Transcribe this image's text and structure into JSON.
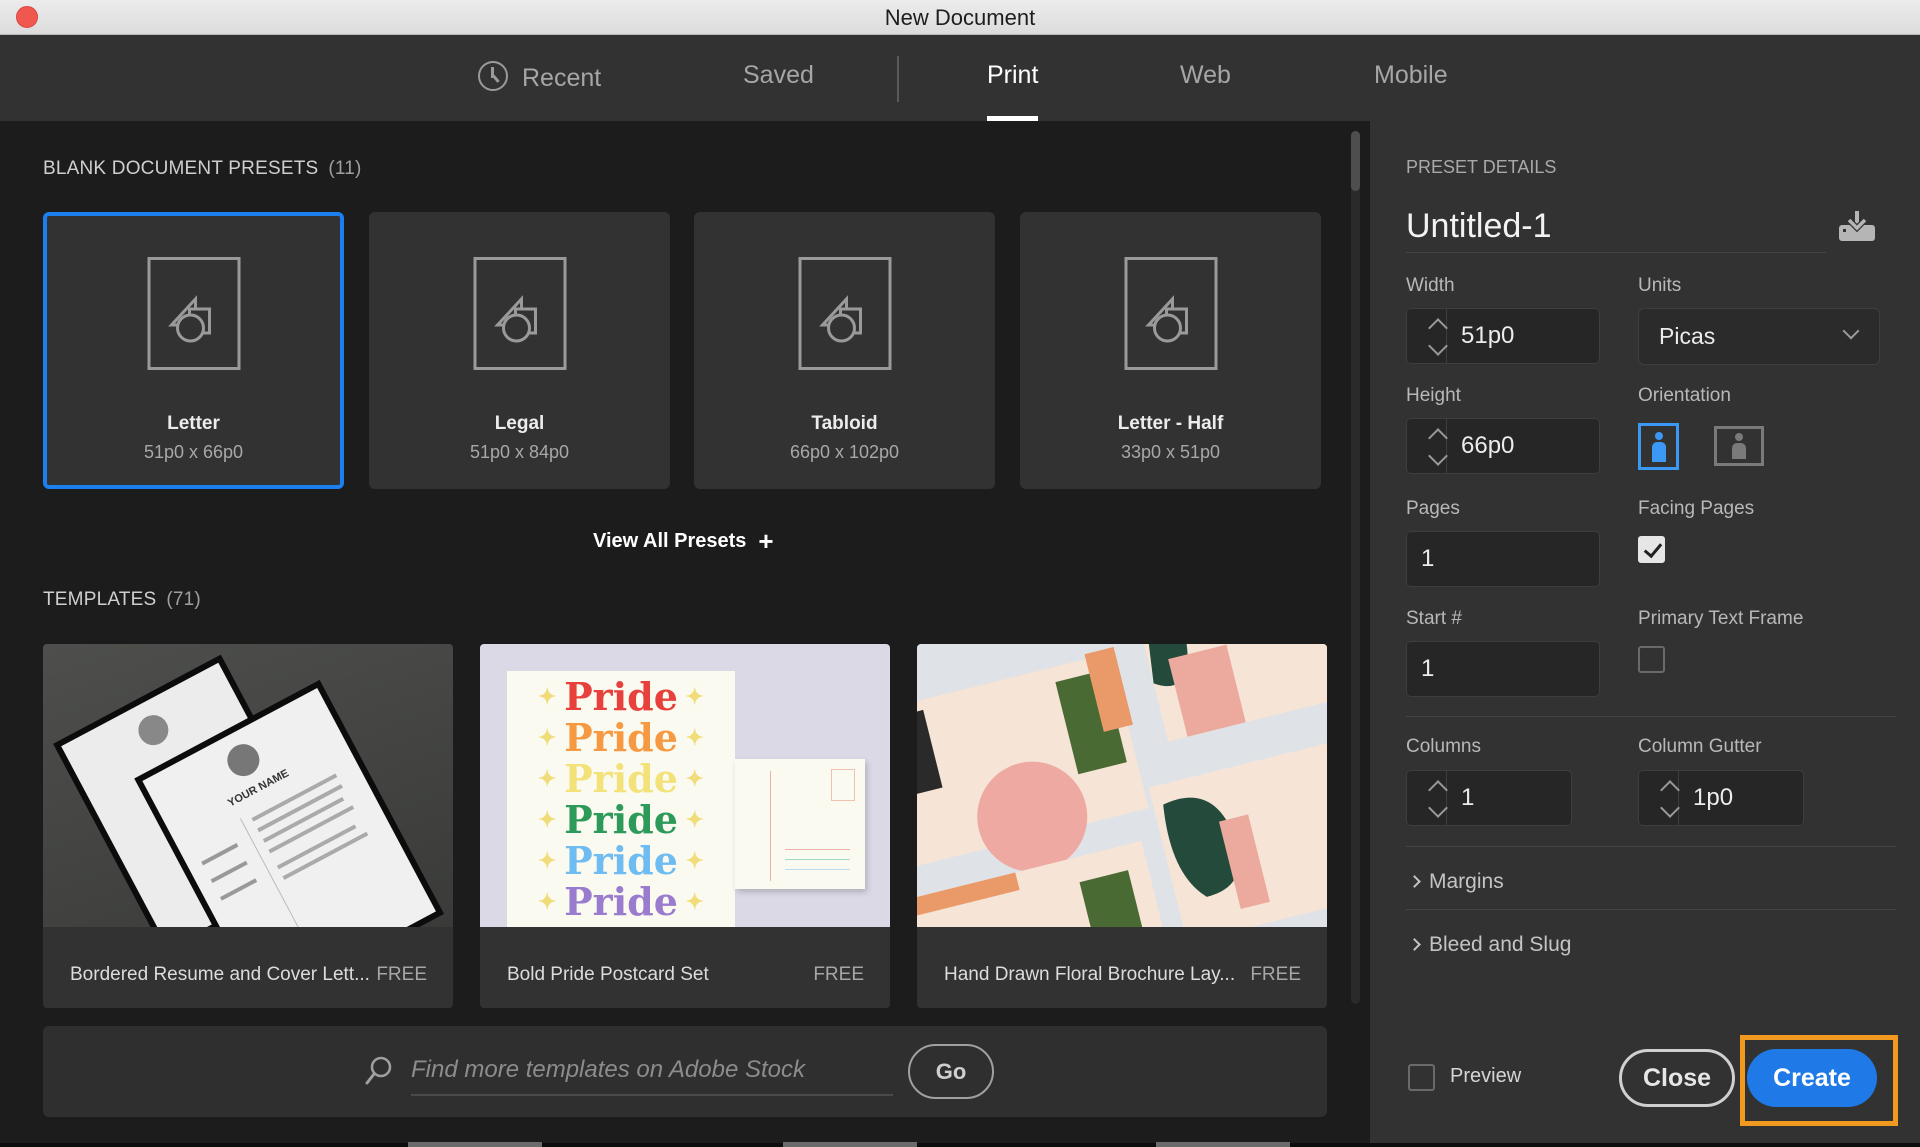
{
  "window": {
    "title": "New Document"
  },
  "tabs": [
    {
      "label": "Recent",
      "icon": "clock-icon",
      "active": false
    },
    {
      "label": "Saved",
      "active": false
    },
    {
      "label": "Print",
      "active": true
    },
    {
      "label": "Web",
      "active": false
    },
    {
      "label": "Mobile",
      "active": false
    }
  ],
  "presets": {
    "heading": "BLANK DOCUMENT PRESETS",
    "count": "(11)",
    "items": [
      {
        "name": "Letter",
        "size": "51p0 x 66p0",
        "selected": true
      },
      {
        "name": "Legal",
        "size": "51p0 x 84p0",
        "selected": false
      },
      {
        "name": "Tabloid",
        "size": "66p0 x 102p0",
        "selected": false
      },
      {
        "name": "Letter - Half",
        "size": "33p0 x 51p0",
        "selected": false
      }
    ],
    "view_all_label": "View All Presets",
    "view_all_icon": "+"
  },
  "templates": {
    "heading": "TEMPLATES",
    "count": "(71)",
    "items": [
      {
        "title": "Bordered Resume and Cover Lett...",
        "price": "FREE",
        "thumb_text": "YOUR NAME"
      },
      {
        "title": "Bold Pride Postcard Set",
        "price": "FREE",
        "thumb_text": "Pride"
      },
      {
        "title": "Hand Drawn Floral Brochure Lay...",
        "price": "FREE"
      }
    ],
    "pride_colors": [
      "#e8403c",
      "#f59a42",
      "#f3e27a",
      "#2e9a5a",
      "#6ebcf2",
      "#9a7ccf"
    ]
  },
  "search": {
    "placeholder": "Find more templates on Adobe Stock",
    "value": "",
    "go_label": "Go"
  },
  "details": {
    "heading": "PRESET DETAILS",
    "doc_name": "Untitled-1",
    "width_label": "Width",
    "width_value": "51p0",
    "units_label": "Units",
    "units_value": "Picas",
    "height_label": "Height",
    "height_value": "66p0",
    "orientation_label": "Orientation",
    "orientation_value": "portrait",
    "pages_label": "Pages",
    "pages_value": "1",
    "facing_pages_label": "Facing Pages",
    "facing_pages_checked": true,
    "start_label": "Start #",
    "start_value": "1",
    "primary_text_frame_label": "Primary Text Frame",
    "primary_text_frame_checked": false,
    "columns_label": "Columns",
    "columns_value": "1",
    "gutter_label": "Column Gutter",
    "gutter_value": "1p0",
    "margins_label": "Margins",
    "bleed_label": "Bleed and Slug",
    "preview_label": "Preview",
    "preview_checked": false,
    "close_label": "Close",
    "create_label": "Create"
  },
  "colors": {
    "accent": "#1f7ae8",
    "selected_border": "#1b7ff0",
    "highlight": "#f29a20",
    "close_dot": "#f0584f"
  }
}
